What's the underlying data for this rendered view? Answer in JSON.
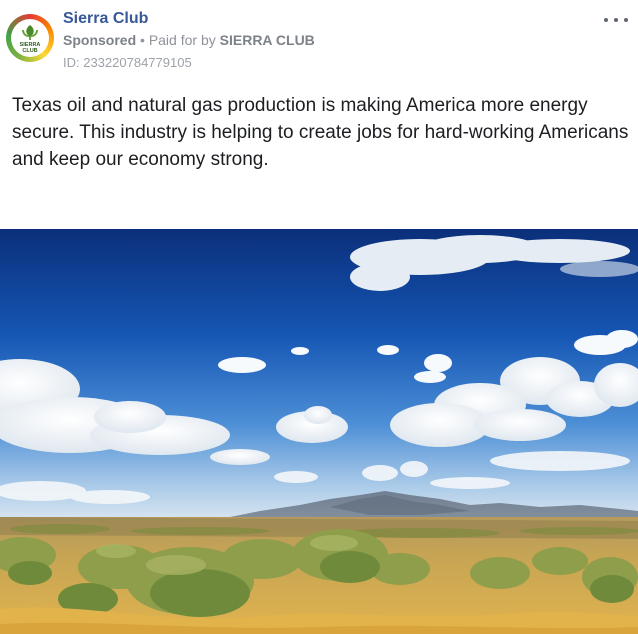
{
  "post": {
    "page_name": "Sierra Club",
    "sponsored_label": "Sponsored",
    "separator": "•",
    "paid_for_prefix": "Paid for by",
    "paid_for_org": "SIERRA CLUB",
    "ad_id": "ID: 233220784779105",
    "more_icon": "more-horizontal-icon",
    "body_text": "Texas oil and natural gas production is making America more energy secure. This industry is helping to create jobs for hard-working Americans and keep our economy strong.",
    "avatar": {
      "logo_line1": "SIERRA",
      "logo_line2": "CLUB",
      "ring_colors": [
        "#e53935",
        "#fb8c00",
        "#fdd835",
        "#7cb342",
        "#43a047"
      ]
    }
  },
  "colors": {
    "page_name": "#385898",
    "meta_text": "#8e939a",
    "body_text": "#1c1e21"
  }
}
